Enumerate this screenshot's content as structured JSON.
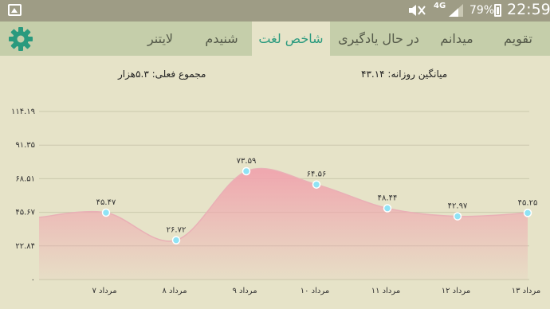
{
  "statusbar": {
    "network": "4G",
    "battery": "79%",
    "time": "22:59"
  },
  "tabs": [
    {
      "label": "تقویم",
      "active": false
    },
    {
      "label": "میدانم",
      "active": false
    },
    {
      "label": "در حال یادگیری",
      "active": false
    },
    {
      "label": "شاخص لغت",
      "active": true
    },
    {
      "label": "شنیدم",
      "active": false
    },
    {
      "label": "لایتنر",
      "active": false
    }
  ],
  "header": {
    "daily_average": "میانگین روزانه: ۴۳.۱۴",
    "total_current": "مجموع فعلی: ۵.۳هزار"
  },
  "colors": {
    "accent": "#2a9a7e",
    "fill": "#f0a3ad",
    "marker": "#8fe3f5"
  },
  "chart_data": {
    "type": "area",
    "categories": [
      "۷ مرداد",
      "۸ مرداد",
      "۹ مرداد",
      "۱۰ مرداد",
      "۱۱ مرداد",
      "۱۲ مرداد",
      "۱۳ مرداد"
    ],
    "values": [
      45.47,
      26.72,
      73.59,
      64.56,
      48.44,
      42.97,
      45.25
    ],
    "value_labels": [
      "۴۵.۴۷",
      "۲۶.۷۲",
      "۷۳.۵۹",
      "۶۴.۵۶",
      "۴۸.۴۴",
      "۴۲.۹۷",
      "۴۵.۲۵"
    ],
    "y_ticks": [
      0,
      22.84,
      45.67,
      68.51,
      91.35,
      114.19
    ],
    "y_tick_labels": [
      "۰",
      "۲۲.۸۴",
      "۴۵.۶۷",
      "۶۸.۵۱",
      "۹۱.۳۵",
      "۱۱۴.۱۹"
    ],
    "ylim": [
      0,
      114.19
    ],
    "grid": true
  }
}
